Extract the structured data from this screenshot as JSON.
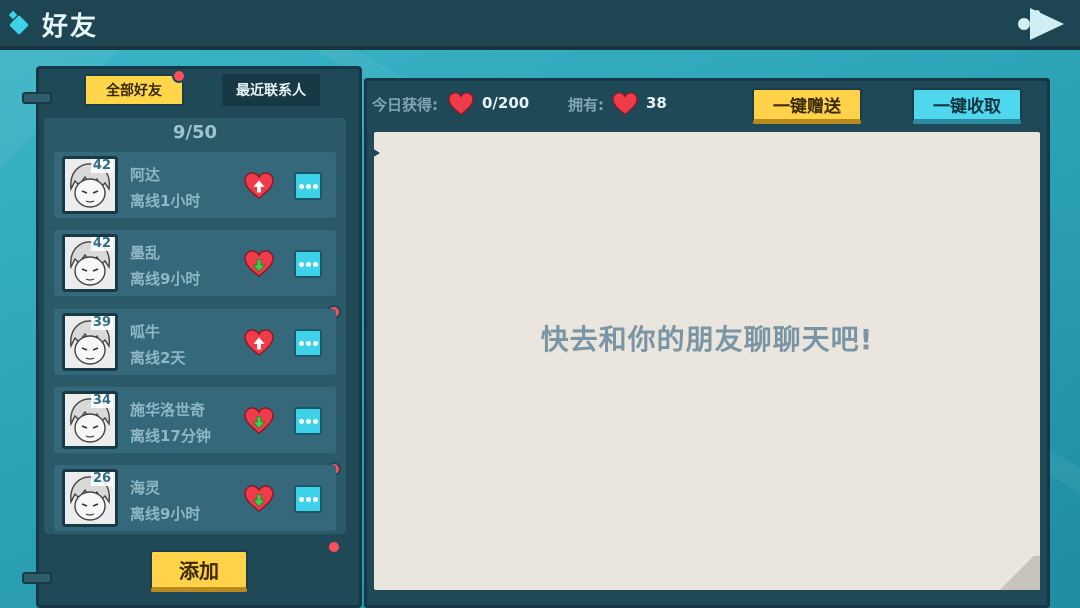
{
  "header": {
    "title": "好友"
  },
  "tabs": {
    "all_label": "全部好友",
    "recent_label": "最近联系人"
  },
  "friend_count": "9/50",
  "friends": [
    {
      "name": "阿达",
      "status": "离线1小时",
      "level": "42",
      "gift": "send",
      "new_badge": false
    },
    {
      "name": "墨乱",
      "status": "离线9小时",
      "level": "42",
      "gift": "receive",
      "new_badge": true
    },
    {
      "name": "呱牛",
      "status": "离线2天",
      "level": "39",
      "gift": "send",
      "new_badge": false
    },
    {
      "name": "施华洛世奇",
      "status": "离线17分钟",
      "level": "34",
      "gift": "receive",
      "new_badge": true
    },
    {
      "name": "海灵",
      "status": "离线9小时",
      "level": "26",
      "gift": "receive",
      "new_badge": true
    }
  ],
  "add_button": "添加",
  "stats": {
    "today_label": "今日获得:",
    "today_value": "0/200",
    "own_label": "拥有:",
    "own_value": "38"
  },
  "actions": {
    "send_all": "一键赠送",
    "collect_all": "一键收取"
  },
  "chat": {
    "empty_message": "快去和你的朋友聊聊天吧!"
  },
  "colors": {
    "accent_yellow": "#ffd24a",
    "accent_cyan": "#4fd7ee",
    "heart_red": "#ef3b4a",
    "badge_red": "#ff4d5e",
    "panel_dark": "#1f4957"
  },
  "icons": {
    "title": "diamond-icon",
    "back": "back-arrow-icon",
    "heart": "heart-icon",
    "more": "more-dots-icon"
  }
}
